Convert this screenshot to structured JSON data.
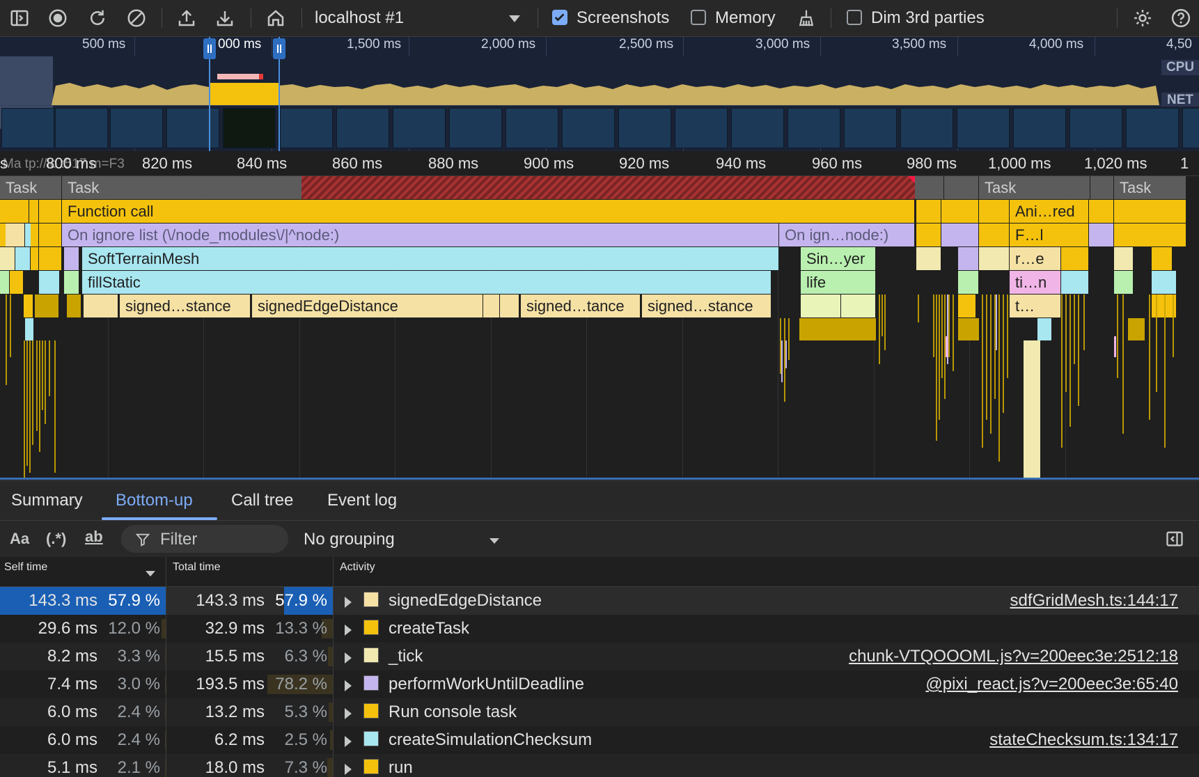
{
  "toolbar": {
    "target": "localhost #1",
    "screenshots_label": "Screenshots",
    "screenshots_checked": true,
    "memory_label": "Memory",
    "memory_checked": false,
    "dim_label": "Dim 3rd parties",
    "dim_checked": false
  },
  "overview": {
    "ticks": [
      "500 ms",
      "000 ms",
      "1,500 ms",
      "2,000 ms",
      "2,500 ms",
      "3,000 ms",
      "3,500 ms",
      "4,000 ms",
      "4,50"
    ],
    "cpu_label": "CPU",
    "net_label": "NET"
  },
  "ruler": {
    "ticks": [
      "s",
      "800 ms",
      "820 ms",
      "840 ms",
      "860 ms",
      "880 ms",
      "900 ms",
      "920 ms",
      "940 ms",
      "960 ms",
      "980 ms",
      "1,000 ms",
      "1,020 ms",
      "1"
    ],
    "ghost_text": "Ma   tp://lo      :517   m=F3"
  },
  "flame": {
    "task_a": "Task",
    "task_b": "Task",
    "task_c": "Task",
    "task_d": "Task",
    "function_call": "Function call",
    "ani_red": "Ani…red",
    "ignore_list": "On ignore list (\\/node_modules\\/|^node:)",
    "ignore_short": "On ign…node:)",
    "f_l": "F…l",
    "soft_terrain": "SoftTerrainMesh",
    "sin_yer": "Sin…yer",
    "r_e": "r…e",
    "fill_static": "fillStatic",
    "life": "life",
    "ti_n": "ti…n",
    "signed_1": "signed…stance",
    "signed_2": "signedEdgeDistance",
    "signed_3": "signed…tance",
    "signed_4": "signed…stance",
    "t_dots": "t…"
  },
  "tabs": [
    "Summary",
    "Bottom-up",
    "Call tree",
    "Event log"
  ],
  "filter": {
    "case_label": "Aa",
    "regex_label": "(.*)",
    "word_label": "ab",
    "placeholder": "Filter",
    "grouping": "No grouping"
  },
  "table": {
    "col_self": "Self time",
    "col_total": "Total time",
    "col_activity": "Activity",
    "rows": [
      {
        "self_ms": "143.3 ms",
        "self_pct": "57.9 %",
        "total_ms": "143.3 ms",
        "total_pct": "57.9 %",
        "name": "signedEdgeDistance",
        "color": "#f5e1a4",
        "source": "sdfGridMesh.ts:144:17",
        "self_frac": 0.579,
        "total_frac": 0.579
      },
      {
        "self_ms": "29.6 ms",
        "self_pct": "12.0 %",
        "total_ms": "32.9 ms",
        "total_pct": "13.3 %",
        "name": "createTask",
        "color": "#f4c20d",
        "source": "",
        "self_frac": 0.12,
        "total_frac": 0.133
      },
      {
        "self_ms": "8.2 ms",
        "self_pct": "3.3 %",
        "total_ms": "15.5 ms",
        "total_pct": "6.3 %",
        "name": "_tick",
        "color": "#f1e9b0",
        "source": "chunk-VTQOOOML.js?v=200eec3e:2512:18",
        "self_frac": 0.033,
        "total_frac": 0.063
      },
      {
        "self_ms": "7.4 ms",
        "self_pct": "3.0 %",
        "total_ms": "193.5 ms",
        "total_pct": "78.2 %",
        "name": "performWorkUntilDeadline",
        "color": "#c5b5ee",
        "source": "@pixi_react.js?v=200eec3e:65:40",
        "self_frac": 0.03,
        "total_frac": 0.782
      },
      {
        "self_ms": "6.0 ms",
        "self_pct": "2.4 %",
        "total_ms": "13.2 ms",
        "total_pct": "5.3 %",
        "name": "Run console task",
        "color": "#f4c20d",
        "source": "",
        "self_frac": 0.024,
        "total_frac": 0.053
      },
      {
        "self_ms": "6.0 ms",
        "self_pct": "2.4 %",
        "total_ms": "6.2 ms",
        "total_pct": "2.5 %",
        "name": "createSimulationChecksum",
        "color": "#a8e6f0",
        "source": "stateChecksum.ts:134:17",
        "self_frac": 0.024,
        "total_frac": 0.025
      },
      {
        "self_ms": "5.1 ms",
        "self_pct": "2.1 %",
        "total_ms": "18.0 ms",
        "total_pct": "7.3 %",
        "name": "run",
        "color": "#f4c20d",
        "source": "",
        "self_frac": 0.021,
        "total_frac": 0.073
      }
    ]
  }
}
